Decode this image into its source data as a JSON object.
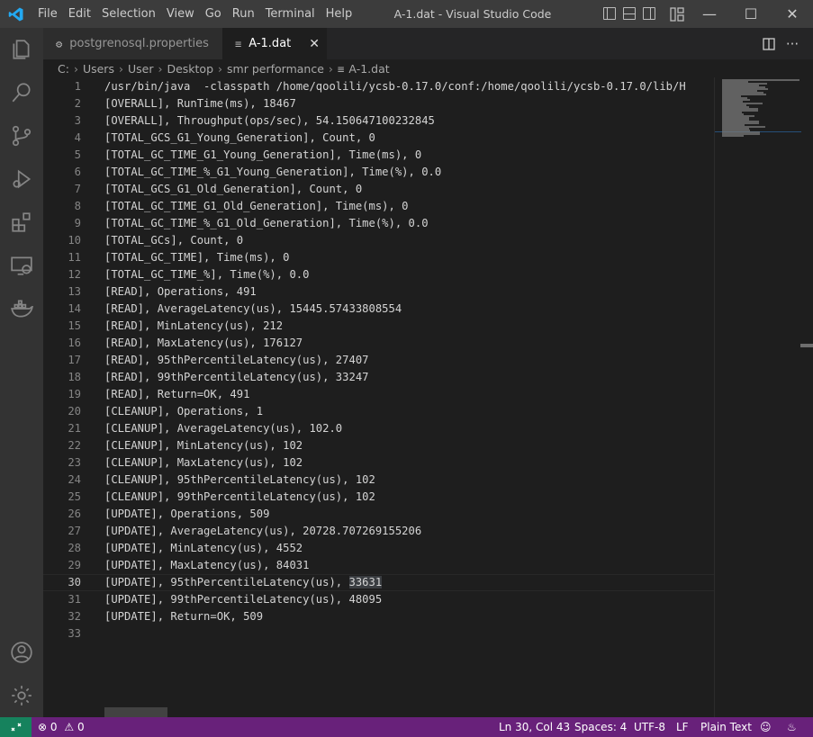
{
  "titlebar": {
    "menu": [
      "File",
      "Edit",
      "Selection",
      "View",
      "Go",
      "Run",
      "Terminal",
      "Help"
    ],
    "title": "A-1.dat - Visual Studio Code"
  },
  "tabs": [
    {
      "label": "postgrenosql.properties",
      "icon": "settings-file-icon"
    },
    {
      "label": "A-1.dat",
      "icon": "text-file-icon",
      "active": true
    }
  ],
  "breadcrumb": [
    "C:",
    "Users",
    "User",
    "Desktop",
    "smr performance",
    "A-1.dat"
  ],
  "editor": {
    "current_line": 30,
    "selected_text": "33631",
    "lines": [
      "/usr/bin/java  -classpath /home/qoolili/ycsb-0.17.0/conf:/home/qoolili/ycsb-0.17.0/lib/H",
      "[OVERALL], RunTime(ms), 18467",
      "[OVERALL], Throughput(ops/sec), 54.150647100232845",
      "[TOTAL_GCS_G1_Young_Generation], Count, 0",
      "[TOTAL_GC_TIME_G1_Young_Generation], Time(ms), 0",
      "[TOTAL_GC_TIME_%_G1_Young_Generation], Time(%), 0.0",
      "[TOTAL_GCS_G1_Old_Generation], Count, 0",
      "[TOTAL_GC_TIME_G1_Old_Generation], Time(ms), 0",
      "[TOTAL_GC_TIME_%_G1_Old_Generation], Time(%), 0.0",
      "[TOTAL_GCs], Count, 0",
      "[TOTAL_GC_TIME], Time(ms), 0",
      "[TOTAL_GC_TIME_%], Time(%), 0.0",
      "[READ], Operations, 491",
      "[READ], AverageLatency(us), 15445.57433808554",
      "[READ], MinLatency(us), 212",
      "[READ], MaxLatency(us), 176127",
      "[READ], 95thPercentileLatency(us), 27407",
      "[READ], 99thPercentileLatency(us), 33247",
      "[READ], Return=OK, 491",
      "[CLEANUP], Operations, 1",
      "[CLEANUP], AverageLatency(us), 102.0",
      "[CLEANUP], MinLatency(us), 102",
      "[CLEANUP], MaxLatency(us), 102",
      "[CLEANUP], 95thPercentileLatency(us), 102",
      "[CLEANUP], 99thPercentileLatency(us), 102",
      "[UPDATE], Operations, 509",
      "[UPDATE], AverageLatency(us), 20728.707269155206",
      "[UPDATE], MinLatency(us), 4552",
      "[UPDATE], MaxLatency(us), 84031",
      "[UPDATE], 95thPercentileLatency(us), 33631",
      "[UPDATE], 99thPercentileLatency(us), 48095",
      "[UPDATE], Return=OK, 509",
      ""
    ]
  },
  "statusbar": {
    "errors": "0",
    "warnings": "0",
    "position": "Ln 30, Col 43",
    "spaces": "Spaces: 4",
    "encoding": "UTF-8",
    "eol": "LF",
    "language": "Plain Text"
  },
  "colors": {
    "statusbar": "#68217a",
    "remote": "#16825d",
    "accent": "#007acc"
  }
}
